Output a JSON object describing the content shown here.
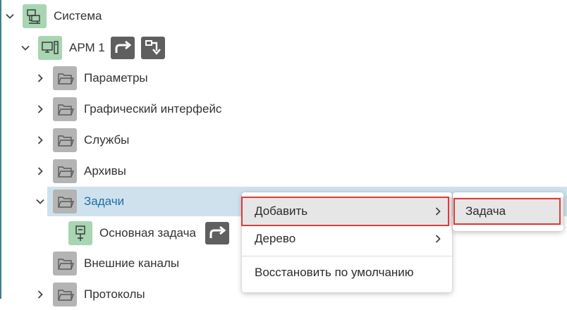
{
  "tree": {
    "root": {
      "label": "Система",
      "icon": "computer-network-icon"
    },
    "arm": {
      "label": "АРМ 1",
      "icon": "computer-icon",
      "action1_icon": "redirect-arrow-icon",
      "action2_icon": "hierarchy-arrow-icon"
    },
    "folders": [
      {
        "label": "Параметры"
      },
      {
        "label": "Графический интерфейс"
      },
      {
        "label": "Службы"
      },
      {
        "label": "Архивы"
      }
    ],
    "tasks": {
      "label": "Задачи"
    },
    "main_task": {
      "label": "Основная задача",
      "icon": "chip-icon",
      "action_icon": "redirect-arrow-icon"
    },
    "external_channels": {
      "label": "Внешние каналы"
    },
    "protocols": {
      "label": "Протоколы"
    }
  },
  "context_menu": {
    "items": [
      {
        "label": "Добавить",
        "has_submenu": true
      },
      {
        "label": "Дерево",
        "has_submenu": true
      },
      {
        "label": "Восстановить по умолчанию",
        "has_submenu": false
      }
    ]
  },
  "submenu": {
    "items": [
      {
        "label": "Задача"
      }
    ]
  },
  "colors": {
    "selection": "#cfe1ec",
    "highlight_box": "#e23a3a",
    "green_icon_bg": "#a8d5b2",
    "folder_icon_bg": "#b4b4b4",
    "action_button_bg": "#5f5f5f",
    "link_text": "#1f6fa8"
  }
}
